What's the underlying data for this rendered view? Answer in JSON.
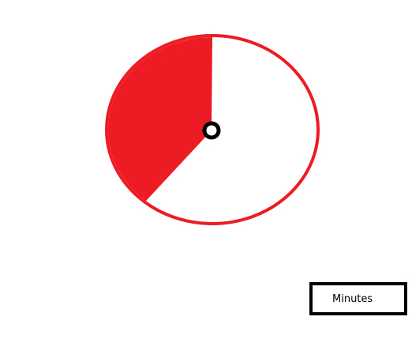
{
  "timer": {
    "remaining_fraction": 0.39,
    "colors": {
      "accent": "#ED1C24",
      "face": "#FFFFFF",
      "hub_outline": "#000000"
    }
  },
  "units_box": {
    "label": "Minutes"
  }
}
